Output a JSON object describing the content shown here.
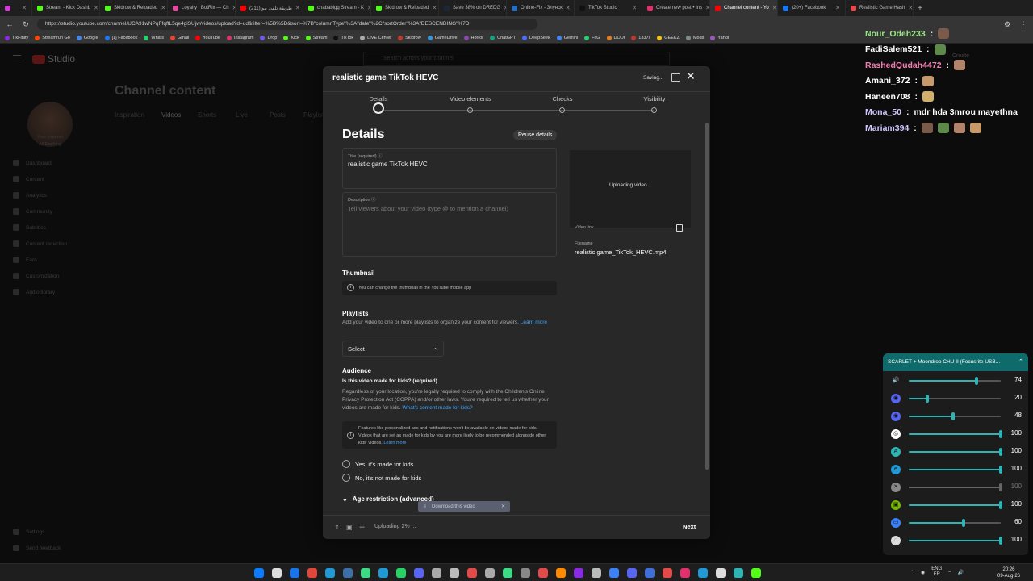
{
  "browser": {
    "tabs": [
      {
        "label": "",
        "color": "#cc3fd1",
        "x": ""
      },
      {
        "label": "Stream - Kick Dashb",
        "color": "#53fc18"
      },
      {
        "label": "Skidrow & Reloaded",
        "color": "#53fc18"
      },
      {
        "label": "Loyalty | BotRix — Ch",
        "color": "#e04b9e"
      },
      {
        "label": "(211) طريقة تلفي بيو",
        "color": "#ff0000"
      },
      {
        "label": "chabablgg Stream - K",
        "color": "#53fc18"
      },
      {
        "label": "Skidrow & Reloaded",
        "color": "#53fc18"
      },
      {
        "label": "Save 38% on DREDG",
        "color": "#1b2838"
      },
      {
        "label": "Online-Fix - Злунск",
        "color": "#2a6fbf"
      },
      {
        "label": "TikTok Studio",
        "color": "#111111"
      },
      {
        "label": "Create new post • Ins",
        "color": "#e1306c"
      },
      {
        "label": "Channel content - Yo",
        "color": "#ff0000"
      },
      {
        "label": "(20+) Facebook",
        "color": "#1877f2"
      },
      {
        "label": "Realistic Game Hash",
        "color": "#e34b4b"
      }
    ],
    "url": "https://studio.youtube.com/channel/UCA91wNPqFfqftL5qe4giSUjw/videos/upload?d=ud&filter=%5B%5D&sort=%7B\"columnType\"%3A\"date\"%2C\"sortOrder\"%3A\"DESCENDING\"%7D",
    "bookmarks": [
      "TikFinity",
      "Streamrun Go",
      "Google",
      "[1] Facebook",
      "Whats",
      "Gmail",
      "YouTube",
      "Instagram",
      "Drop",
      "Kick",
      "Stream",
      "TikTok",
      "LIVE Center",
      "Skidrow",
      "GameDrive",
      "Horror",
      "ChatGPT",
      "DeepSeek",
      "Gemini",
      "FitG",
      "DODI",
      "1337x",
      "GEEKZ",
      "Mods",
      "Yandi"
    ]
  },
  "studio": {
    "logo_text": "Studio",
    "search_placeholder": "Search across your channel",
    "page_title": "Channel content",
    "channel_label": "Your channel",
    "channel_name": "Ali Dashing",
    "tabs": [
      "Inspiration",
      "Videos",
      "Shorts",
      "Live",
      "Posts",
      "Playlists"
    ],
    "sidebar": [
      "Dashboard",
      "Content",
      "Analytics",
      "Community",
      "Subtitles",
      "Content detection",
      "Earn",
      "Customization",
      "Audio library"
    ],
    "sidebar_bottom": [
      "Settings",
      "Send feedback"
    ],
    "create_label": "Create"
  },
  "modal": {
    "title": "realistic game TikTok HEVC",
    "saving": "Saving...",
    "steps": [
      "Details",
      "Video elements",
      "Checks",
      "Visibility"
    ],
    "heading": "Details",
    "reuse": "Reuse details",
    "title_label": "Title (required)",
    "title_value": "realistic game TikTok HEVC",
    "desc_label": "Description",
    "desc_placeholder": "Tell viewers about your video (type @ to mention a channel)",
    "uploading_preview": "Uploading video...",
    "video_link_label": "Video link",
    "filename_label": "Filename",
    "filename": "realistic game_TikTok_HEVC.mp4",
    "thumbnail_h": "Thumbnail",
    "thumbnail_info": "You can change the thumbnail in the YouTube mobile app",
    "playlists_h": "Playlists",
    "playlists_p": "Add your video to one or more playlists to organize your content for viewers.",
    "learn_more": "Learn more",
    "select": "Select",
    "audience_h": "Audience",
    "audience_q": "Is this video made for kids? (required)",
    "audience_p": "Regardless of your location, you're legally required to comply with the Children's Online Privacy Protection Act (COPPA) and/or other laws. You're required to tell us whether your videos are made for kids.",
    "audience_link": "What's content made for kids?",
    "kids_info": "Features like personalized ads and notifications won't be available on videos made for kids. Videos that are set as made for kids by you are more likely to be recommended alongside other kids' videos.",
    "kids_learn": "Learn more",
    "radio_yes": "Yes, it's made for kids",
    "radio_no": "No, it's not made for kids",
    "age_restriction": "Age restriction (advanced)",
    "upload_status": "Uploading 2% ...",
    "next": "Next"
  },
  "download_chip": "Download this video",
  "chat": [
    {
      "user": "Nour_Odeh233",
      "color": "#9be28a",
      "msg": "",
      "emotes": 1
    },
    {
      "user": "FadiSalem521",
      "color": "#ffffff",
      "msg": "",
      "emotes": 1
    },
    {
      "user": "RashedQudah4472",
      "color": "#f07fb0",
      "msg": "",
      "emotes": 1
    },
    {
      "user": "Amani_372",
      "color": "#ffffff",
      "msg": "",
      "emotes": 1
    },
    {
      "user": "Haneen708",
      "color": "#ffffff",
      "msg": "",
      "emotes": 1
    },
    {
      "user": "Mona_50",
      "color": "#cfc6ff",
      "msg": "mdr hda 3mrou mayethna",
      "emotes": 0
    },
    {
      "user": "Mariam394",
      "color": "#cfc6ff",
      "msg": "",
      "emotes": 4
    }
  ],
  "mixer": {
    "device": "SCARLET + Moondrop CHU II (Focusrite USB...",
    "rows": [
      {
        "icon": "speaker-icon",
        "value": "74",
        "level": 74,
        "color": "#2fb3b3",
        "muted": false
      },
      {
        "icon": "discord-icon",
        "value": "20",
        "level": 20,
        "color": "#5865f2",
        "muted": false
      },
      {
        "icon": "discord-alt-icon",
        "value": "48",
        "level": 48,
        "color": "#5865f2",
        "muted": false
      },
      {
        "icon": "steam-icon",
        "value": "100",
        "level": 100,
        "color": "#ffffff",
        "muted": false
      },
      {
        "icon": "app-a-icon",
        "value": "100",
        "level": 100,
        "color": "#2fb3b3",
        "muted": false
      },
      {
        "icon": "edge-icon",
        "value": "100",
        "level": 100,
        "color": "#1f9ad6",
        "muted": false
      },
      {
        "icon": "muted-icon",
        "value": "100",
        "level": 100,
        "color": "#888888",
        "muted": true
      },
      {
        "icon": "nvidia-icon",
        "value": "100",
        "level": 100,
        "color": "#76b900",
        "muted": false
      },
      {
        "icon": "window-icon",
        "value": "60",
        "level": 60,
        "color": "#3b82f6",
        "muted": false
      },
      {
        "icon": "obs-icon",
        "value": "100",
        "level": 100,
        "color": "#dddddd",
        "muted": false
      }
    ]
  },
  "taskbar": {
    "lang": "ENG",
    "lang2": "FR",
    "time": "20:26",
    "date": "09-Aug-26"
  }
}
